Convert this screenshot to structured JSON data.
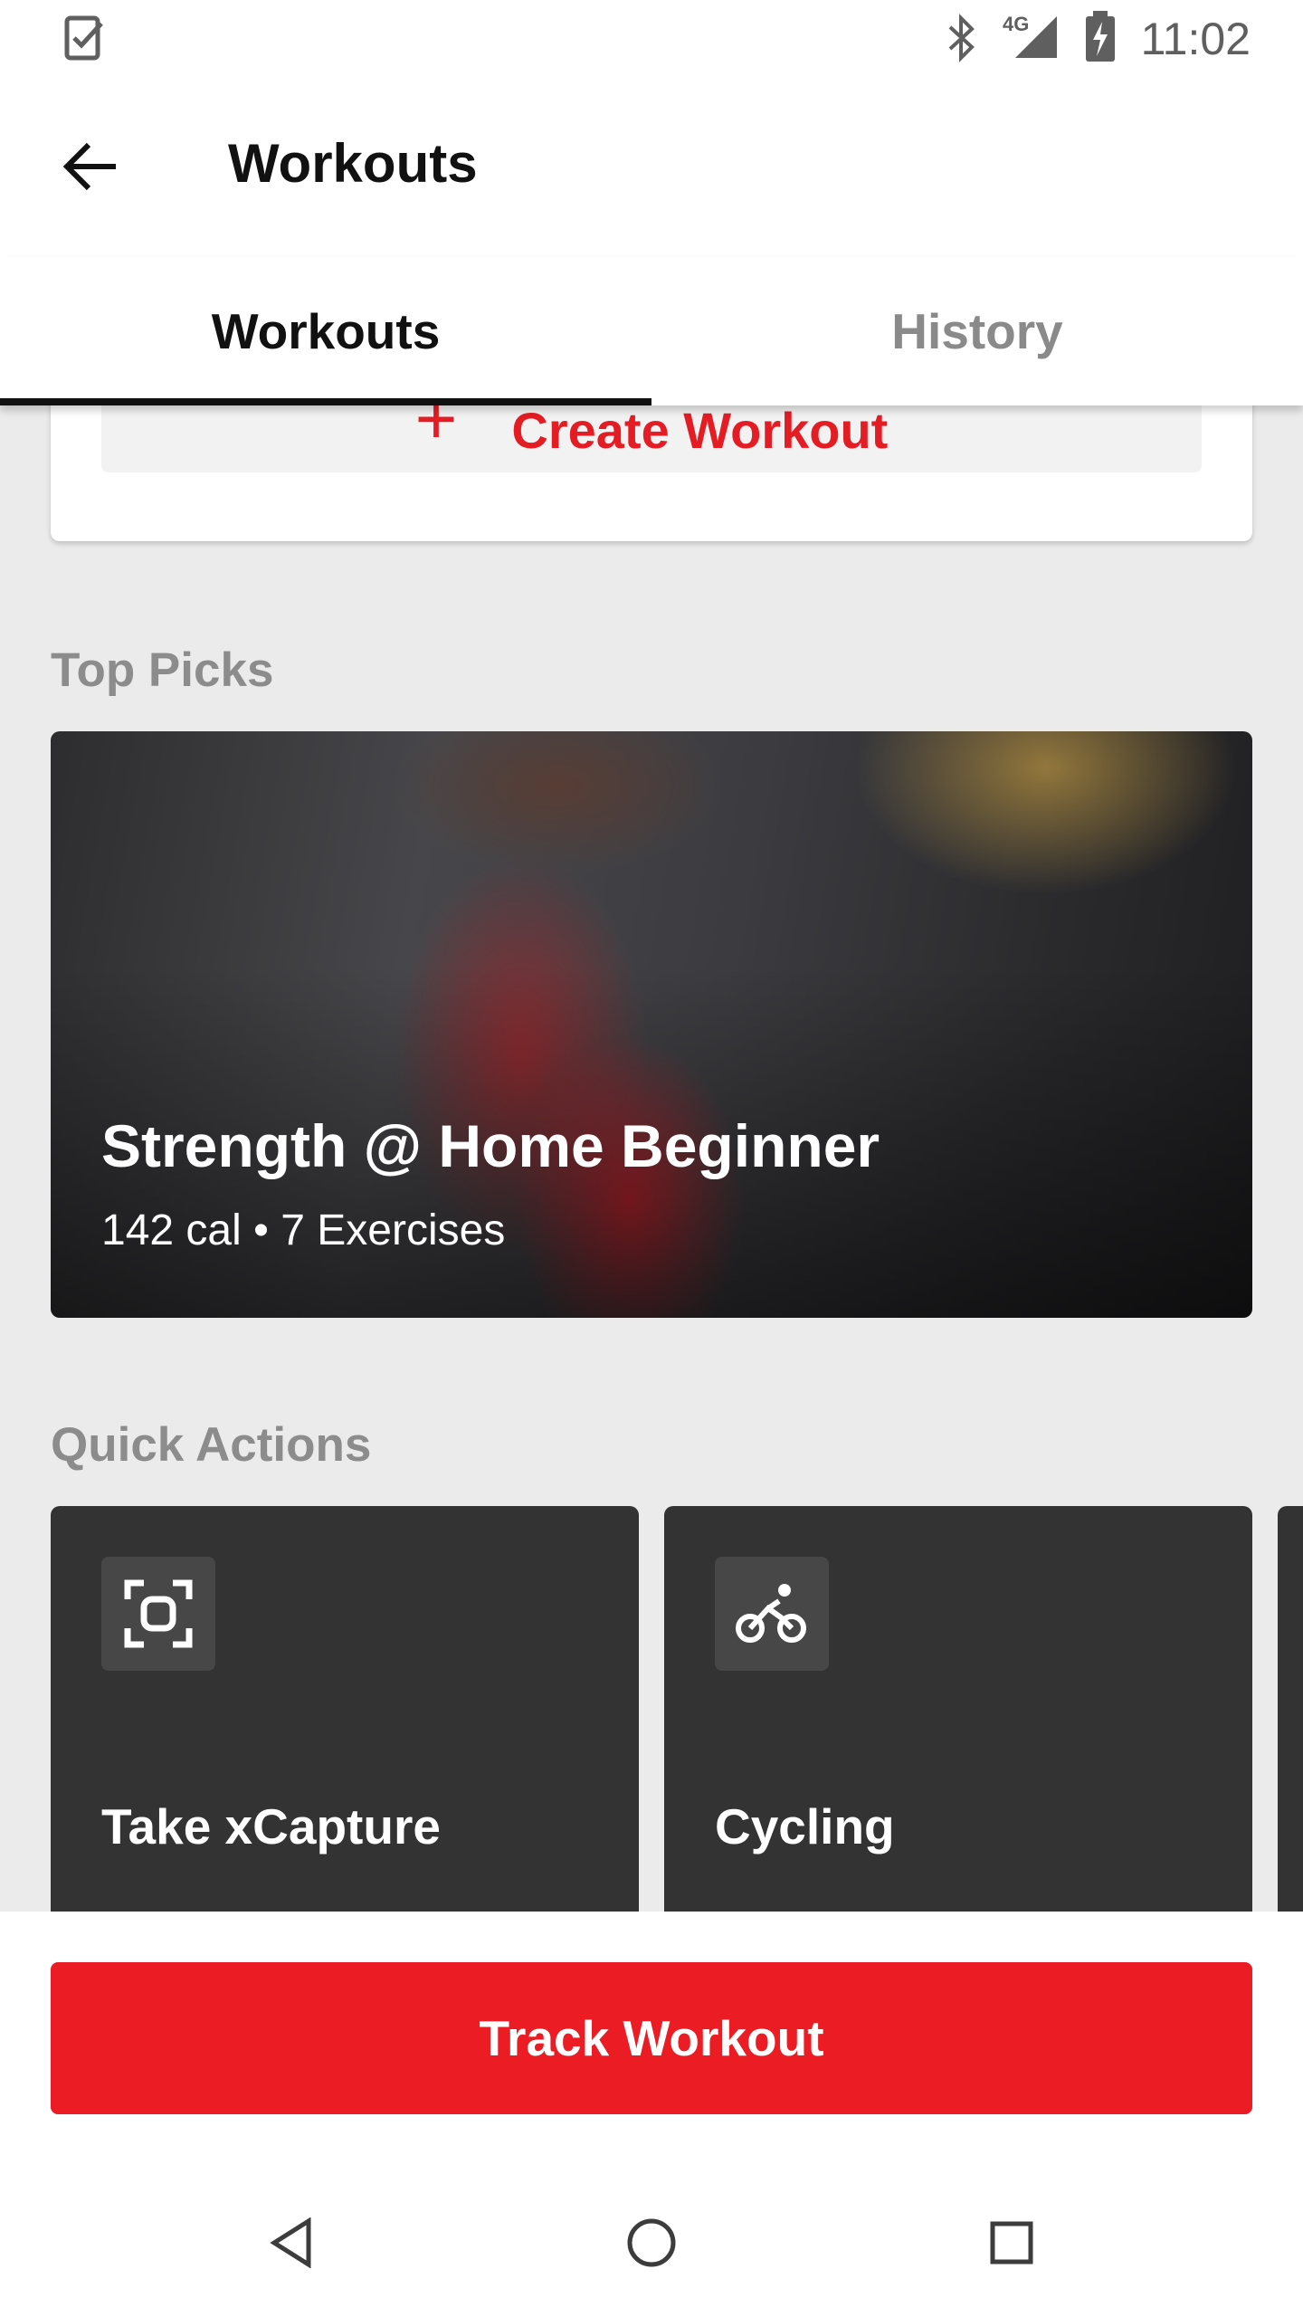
{
  "status_bar": {
    "time": "11:02",
    "network": "4G",
    "icons": [
      "task-check-icon",
      "bluetooth-icon",
      "signal-icon",
      "battery-charging-icon"
    ]
  },
  "app_bar": {
    "title": "Workouts",
    "back_icon": "arrow-left-icon"
  },
  "tabs": [
    {
      "label": "Workouts",
      "selected": true
    },
    {
      "label": "History",
      "selected": false
    }
  ],
  "create_workout": {
    "label": "Create Workout",
    "icon": "plus-icon"
  },
  "top_picks": {
    "heading": "Top Picks",
    "card": {
      "title": "Strength @ Home Beginner",
      "subtitle": "142 cal • 7 Exercises"
    }
  },
  "quick_actions": {
    "heading": "Quick Actions",
    "items": [
      {
        "label": "Take xCapture",
        "icon": "scan-frame-icon"
      },
      {
        "label": "Cycling",
        "icon": "bicycle-icon"
      }
    ]
  },
  "primary_action": {
    "label": "Track Workout"
  },
  "colors": {
    "accent": "#ec1c24",
    "card_dark": "#333333",
    "background": "#ebebeb"
  }
}
